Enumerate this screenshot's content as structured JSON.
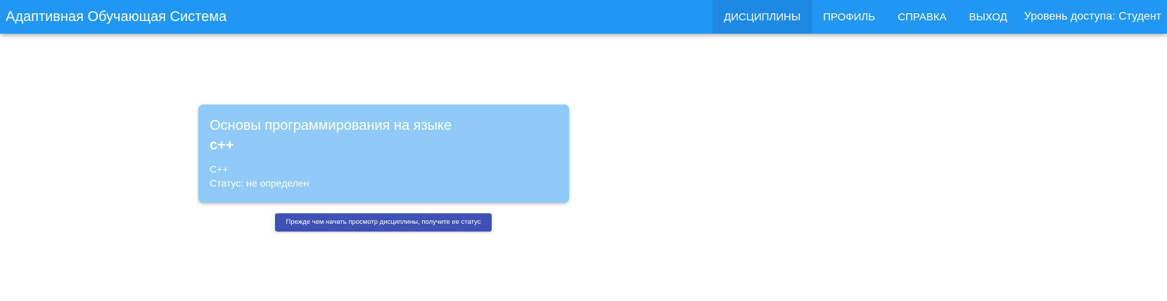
{
  "app": {
    "title": "Адаптивная Обучающая Система"
  },
  "nav": {
    "items": [
      {
        "label": "Дисциплины",
        "active": true
      },
      {
        "label": "Профиль",
        "active": false
      },
      {
        "label": "Справка",
        "active": false
      },
      {
        "label": "Выход",
        "active": false
      }
    ],
    "access_level": "Уровень доступа: Студент"
  },
  "discipline_card": {
    "title_line1": "Основы программирования на языке",
    "title_line2": "с++",
    "short_name": "С++",
    "status": "Статус: не определен"
  },
  "status_button": {
    "label": "Прежде чем начать просмотр дисциплины, получите ее статус"
  },
  "colors": {
    "navbar": "#2196f3",
    "nav_active": "#1e88e5",
    "card": "#90caf9",
    "button": "#3f51b5"
  }
}
